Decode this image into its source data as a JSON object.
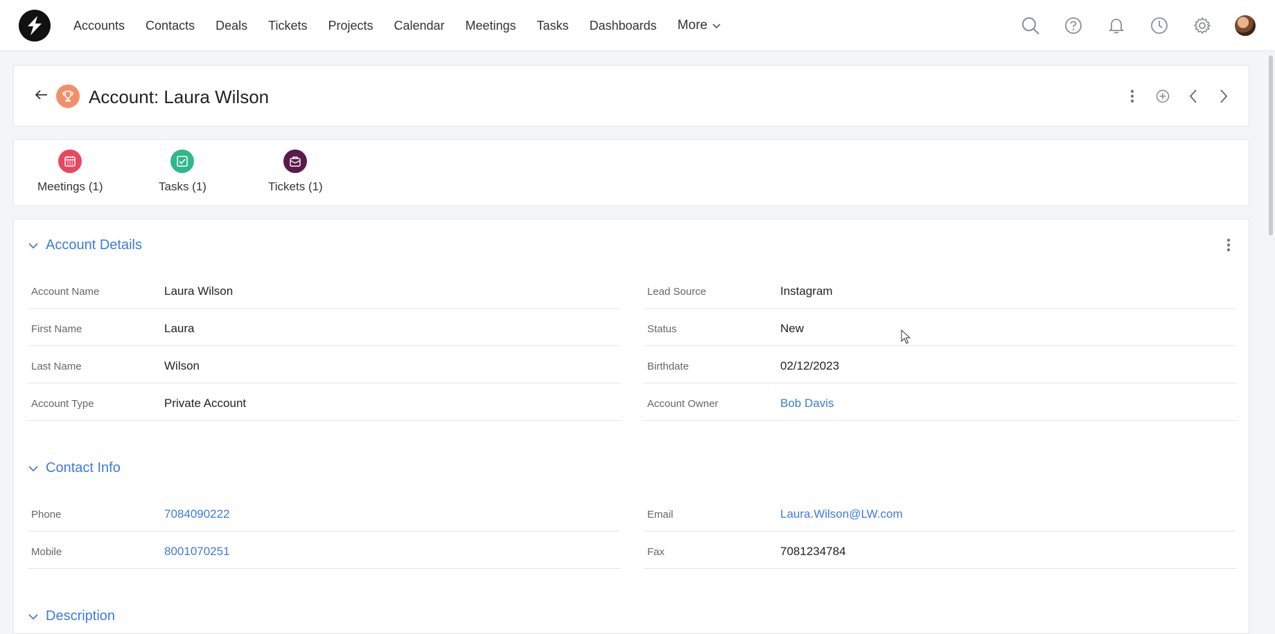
{
  "nav": {
    "links": [
      "Accounts",
      "Contacts",
      "Deals",
      "Tickets",
      "Projects",
      "Calendar",
      "Meetings",
      "Tasks",
      "Dashboards"
    ],
    "more_label": "More",
    "icons": [
      "search-icon",
      "help-icon",
      "bell-icon",
      "history-icon",
      "gear-icon"
    ]
  },
  "header": {
    "title": "Account: Laura Wilson"
  },
  "related": [
    {
      "label": "Meetings (1)",
      "color": "#e8485f",
      "icon": "calendar-icon"
    },
    {
      "label": "Tasks (1)",
      "color": "#2fb88a",
      "icon": "checkbox-icon"
    },
    {
      "label": "Tickets (1)",
      "color": "#5a1a4a",
      "icon": "ticket-icon"
    }
  ],
  "account_details": {
    "title": "Account Details",
    "left": [
      {
        "label": "Account Name",
        "value": "Laura Wilson"
      },
      {
        "label": "First Name",
        "value": "Laura"
      },
      {
        "label": "Last Name",
        "value": "Wilson"
      },
      {
        "label": "Account Type",
        "value": "Private Account"
      }
    ],
    "right": [
      {
        "label": "Lead Source",
        "value": "Instagram"
      },
      {
        "label": "Status",
        "value": "New"
      },
      {
        "label": "Birthdate",
        "value": "02/12/2023"
      },
      {
        "label": "Account Owner",
        "value": "Bob Davis"
      }
    ]
  },
  "contact_info": {
    "title": "Contact Info",
    "left": [
      {
        "label": "Phone",
        "value": "7084090222"
      },
      {
        "label": "Mobile",
        "value": "8001070251"
      }
    ],
    "right": [
      {
        "label": "Email",
        "value": "Laura.Wilson@LW.com"
      },
      {
        "label": "Fax",
        "value": "7081234784"
      }
    ]
  },
  "description": {
    "title": "Description"
  },
  "colors": {
    "accent": "#3d7ae0",
    "account_icon": "#f0906a"
  }
}
